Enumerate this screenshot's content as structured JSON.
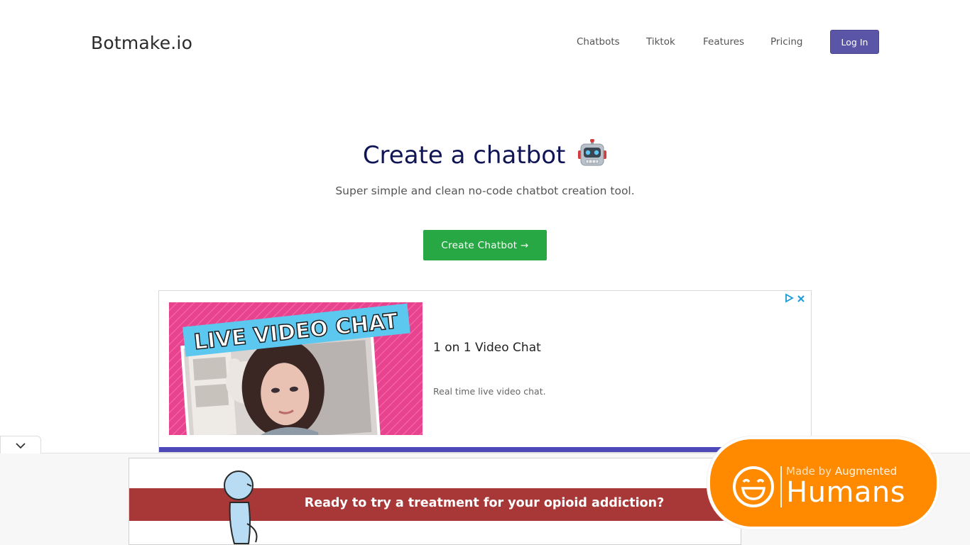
{
  "nav": {
    "brand": "Botmake.io",
    "links": [
      "Chatbots",
      "Tiktok",
      "Features",
      "Pricing"
    ],
    "login_label": "Log In"
  },
  "hero": {
    "title": "Create a chatbot",
    "subtitle": "Super simple and clean no-code chatbot creation tool.",
    "cta_label": "Create Chatbot →"
  },
  "ad": {
    "image_text": "LIVE VIDEO CHAT",
    "headline": "1 on 1 Video Chat",
    "description": "Real time live video chat."
  },
  "bottom_ad": {
    "text": "Ready to try a treatment for your opioid addiction?"
  },
  "badge": {
    "made_by": "Made by",
    "augmented": "Augmented",
    "humans": "Humans"
  },
  "colors": {
    "login_bg": "#5a55a6",
    "cta_bg": "#27a844",
    "title": "#101556",
    "badge_bg": "#ff8a00",
    "bottom_ad_banner": "#a83838"
  }
}
